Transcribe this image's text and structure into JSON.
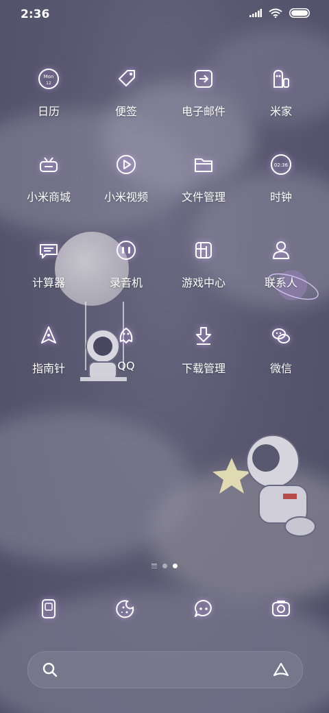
{
  "status_bar": {
    "time": "2:36",
    "icons": [
      "signal-icon",
      "wifi-icon",
      "battery-icon"
    ]
  },
  "apps": [
    {
      "label": "日历",
      "icon": "calendar-icon",
      "icon_text_top": "Mon",
      "icon_text_bottom": "12"
    },
    {
      "label": "便签",
      "icon": "tag-icon"
    },
    {
      "label": "电子邮件",
      "icon": "email-icon"
    },
    {
      "label": "米家",
      "icon": "home-icon"
    },
    {
      "label": "小米商城",
      "icon": "store-icon"
    },
    {
      "label": "小米视频",
      "icon": "video-icon"
    },
    {
      "label": "文件管理",
      "icon": "folder-icon"
    },
    {
      "label": "时钟",
      "icon": "clock-icon",
      "icon_text": "02:36"
    },
    {
      "label": "计算器",
      "icon": "calculator-icon"
    },
    {
      "label": "录音机",
      "icon": "recorder-icon"
    },
    {
      "label": "游戏中心",
      "icon": "game-center-icon"
    },
    {
      "label": "联系人",
      "icon": "contacts-icon"
    },
    {
      "label": "指南针",
      "icon": "compass-icon"
    },
    {
      "label": "QQ",
      "icon": "qq-icon"
    },
    {
      "label": "下载管理",
      "icon": "download-icon"
    },
    {
      "label": "微信",
      "icon": "wechat-icon"
    }
  ],
  "dock": [
    {
      "icon": "phone-icon"
    },
    {
      "icon": "browser-icon"
    },
    {
      "icon": "messages-icon"
    },
    {
      "icon": "camera-icon"
    }
  ],
  "page_indicator": {
    "pages": 3,
    "active": 3
  },
  "search_bar": {
    "left_icon": "search-icon",
    "right_icon": "assistant-icon"
  },
  "colors": {
    "accent": "#c8aaff",
    "icon_stroke": "#ffffff",
    "background": "#5c5a72"
  }
}
